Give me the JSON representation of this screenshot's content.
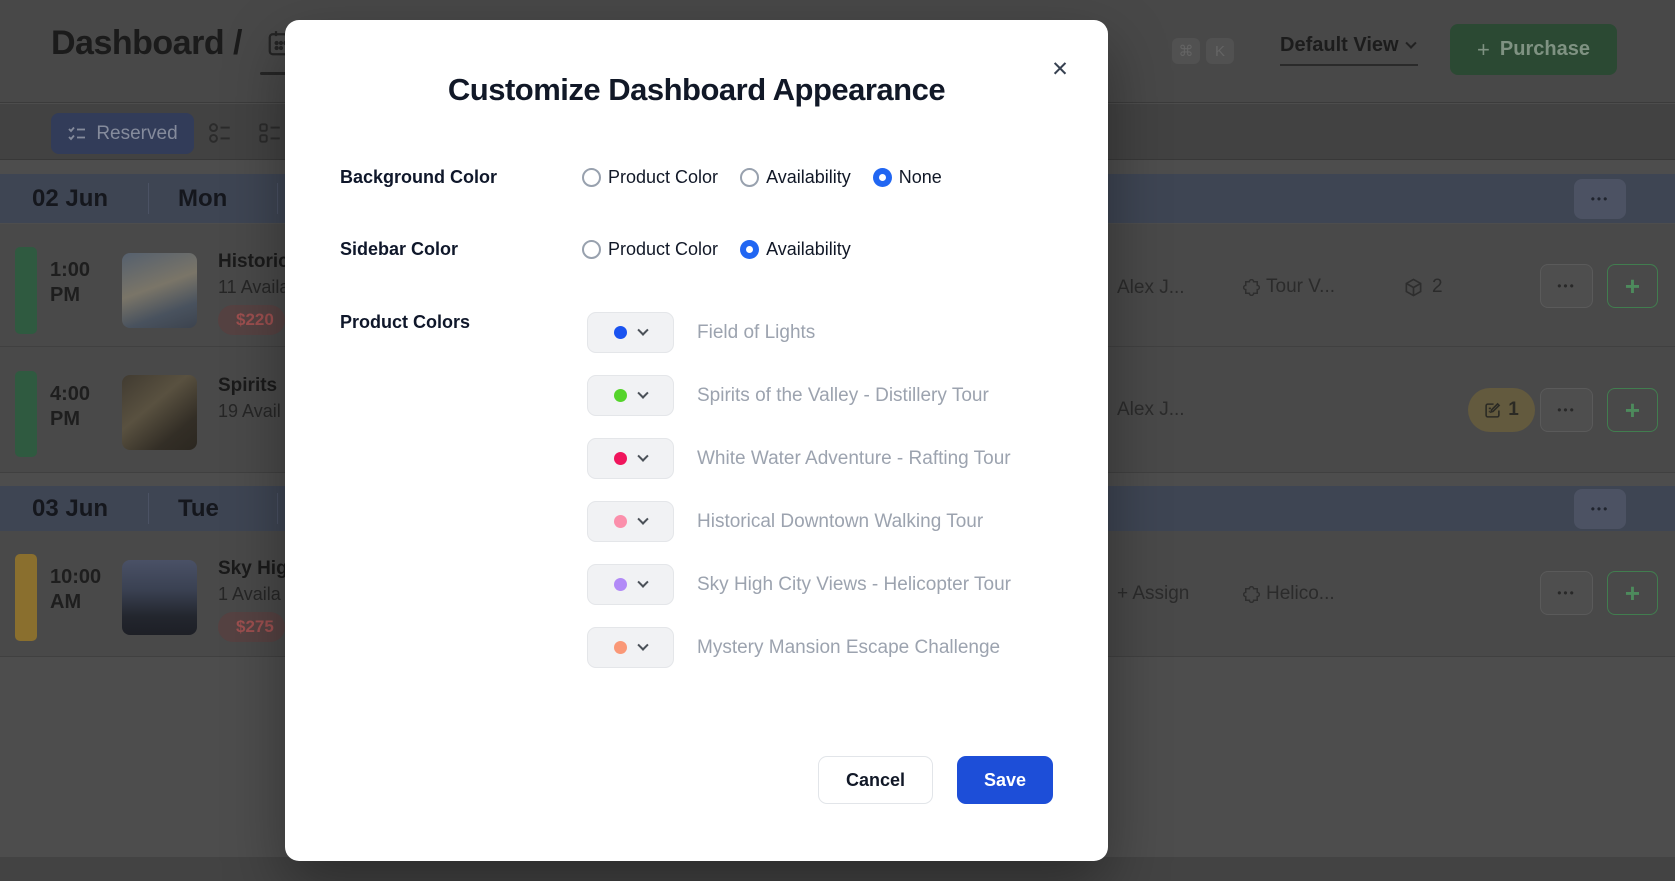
{
  "icons": {
    "close": "✕",
    "plus": "+",
    "ellipsis": "•••"
  },
  "header": {
    "breadcrumb": "Dashboard /",
    "shortcut_cmd": "⌘",
    "shortcut_k": "K",
    "view_dropdown": "Default View",
    "purchase_label": "Purchase"
  },
  "toolbar": {
    "reserved_label": "Reserved"
  },
  "schedule": {
    "day1": {
      "date": "02 Jun",
      "weekday": "Mon"
    },
    "day2": {
      "date": "03 Jun",
      "weekday": "Tue"
    },
    "event1": {
      "time": "1:00",
      "meridiem": "PM",
      "title": "Historic",
      "availability": "11 Availa",
      "price": "$220",
      "staff": "Alex J...",
      "addon": "Tour V...",
      "count": "2"
    },
    "event2": {
      "time": "4:00",
      "meridiem": "PM",
      "title": "Spirits",
      "availability": "19 Avail",
      "staff": "Alex J...",
      "notes_count": "1"
    },
    "event3": {
      "time": "10:00",
      "meridiem": "AM",
      "title": "Sky Hig",
      "availability": "1 Availa",
      "price": "$275",
      "assign_label": "+ Assign",
      "addon": "Helico..."
    }
  },
  "modal": {
    "title": "Customize Dashboard Appearance",
    "background_color": {
      "label": "Background Color",
      "options": [
        "Product Color",
        "Availability",
        "None"
      ],
      "selected": "None"
    },
    "sidebar_color": {
      "label": "Sidebar Color",
      "options": [
        "Product Color",
        "Availability"
      ],
      "selected": "Availability"
    },
    "product_colors": {
      "label": "Product Colors",
      "items": [
        {
          "name": "Field of Lights",
          "color": "#1a53f0"
        },
        {
          "name": "Spirits of the Valley - Distillery Tour",
          "color": "#55d42b"
        },
        {
          "name": "White Water Adventure - Rafting Tour",
          "color": "#f0155c"
        },
        {
          "name": "Historical Downtown Walking Tour",
          "color": "#fb8fab"
        },
        {
          "name": "Sky High City Views - Helicopter Tour",
          "color": "#b28af7"
        },
        {
          "name": "Mystery Mansion Escape Challenge",
          "color": "#fa9877"
        }
      ]
    },
    "cancel_label": "Cancel",
    "save_label": "Save",
    "accent_color": "#1d4ed8",
    "radio_selected_color": "#2166f2"
  }
}
